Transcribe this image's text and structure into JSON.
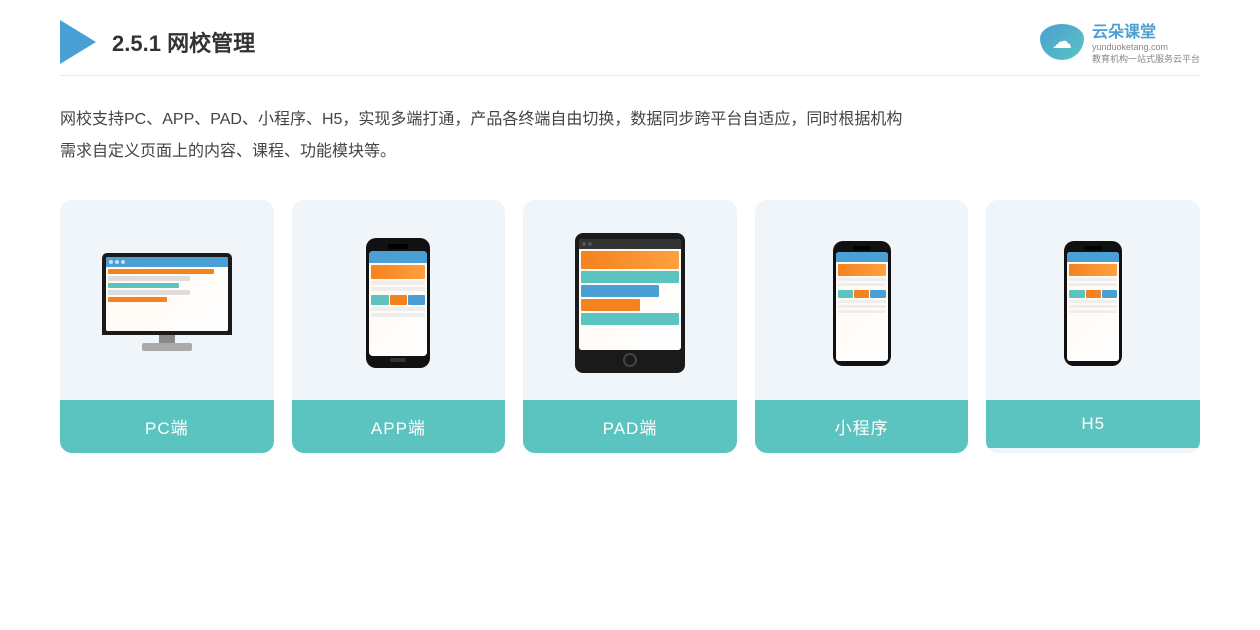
{
  "header": {
    "section_number": "2.5.1",
    "title": "网校管理",
    "brand_name": "云朵课堂",
    "brand_site": "yunduoketang.com",
    "brand_tagline": "教育机构一站式服务云平台"
  },
  "description": {
    "line1": "网校支持PC、APP、PAD、小程序、H5，实现多端打通，产品各终端自由切换，数据同步跨平台自适应，同时根据机构",
    "line2": "需求自定义页面上的内容、课程、功能模块等。"
  },
  "cards": [
    {
      "id": "pc",
      "label": "PC端"
    },
    {
      "id": "app",
      "label": "APP端"
    },
    {
      "id": "pad",
      "label": "PAD端"
    },
    {
      "id": "miniprogram",
      "label": "小程序"
    },
    {
      "id": "h5",
      "label": "H5"
    }
  ]
}
